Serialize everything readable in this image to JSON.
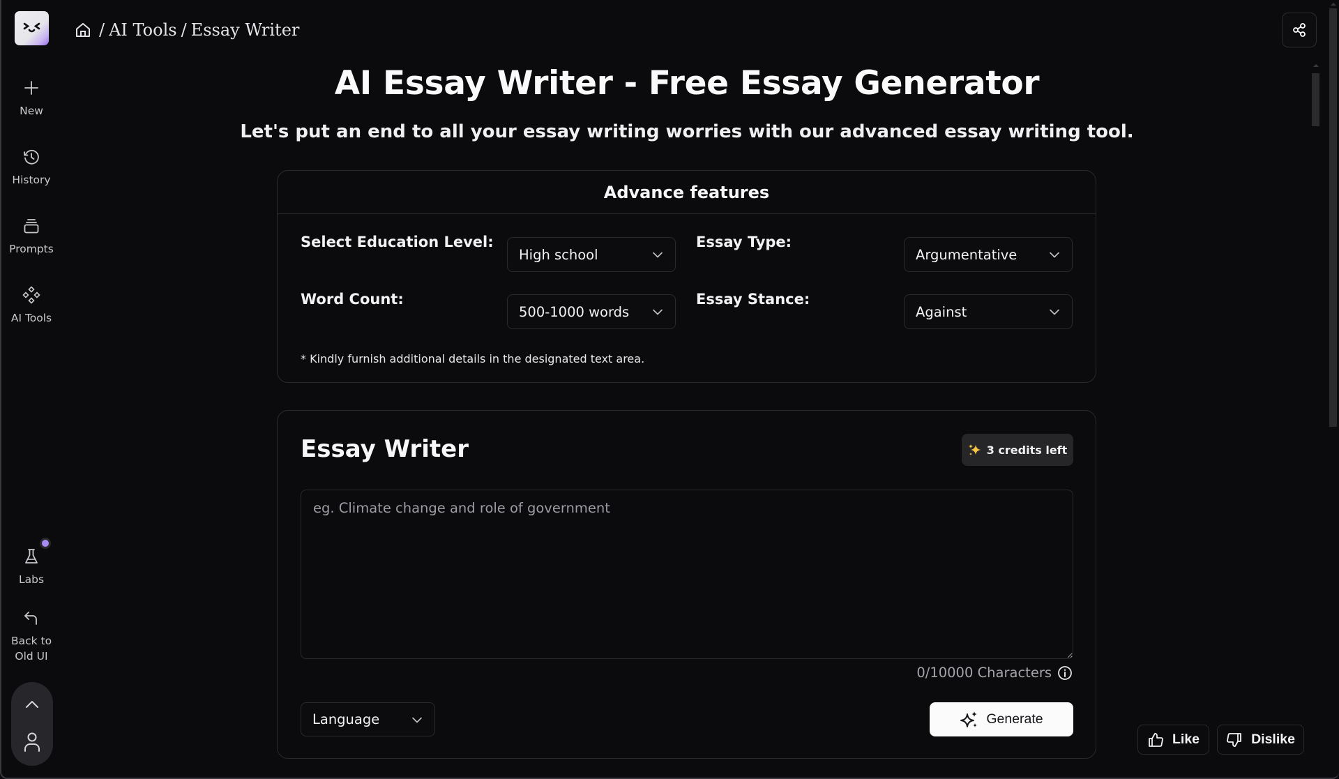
{
  "sidebar": {
    "logo": "smiley-logo",
    "items": [
      {
        "label": "New",
        "icon": "plus-icon"
      },
      {
        "label": "History",
        "icon": "history-icon"
      },
      {
        "label": "Prompts",
        "icon": "stack-icon"
      },
      {
        "label": "AI Tools",
        "icon": "diamonds-icon"
      }
    ],
    "bottom_items": [
      {
        "label": "Labs",
        "icon": "flask-icon",
        "badge_color": "#a98bf4"
      },
      {
        "label_line1": "Back to",
        "label_line2": "Old UI",
        "icon": "back-arrow-icon"
      }
    ],
    "user_menu": {
      "icons": [
        "chevron-up-icon",
        "user-icon"
      ]
    }
  },
  "header": {
    "breadcrumb": [
      "AI Tools",
      "Essay Writer"
    ],
    "separator": "/",
    "share_icon": "share-icon"
  },
  "page": {
    "title": "AI Essay Writer - Free Essay Generator",
    "subtitle": "Let's put an end to all your essay writing worries with our advanced essay writing tool."
  },
  "features": {
    "heading": "Advance features",
    "fields": [
      {
        "label": "Select Education Level:",
        "value": "High school"
      },
      {
        "label": "Essay Type:",
        "value": "Argumentative"
      },
      {
        "label": "Word Count:",
        "value": "500-1000 words"
      },
      {
        "label": "Essay Stance:",
        "value": "Against"
      }
    ],
    "note": "* Kindly furnish additional details in the designated text area."
  },
  "writer": {
    "title": "Essay Writer",
    "credits": "3 credits left",
    "credits_icon_color": "#f5c542",
    "input_value": "",
    "input_placeholder": "eg. Climate change and role of government",
    "char_count": "0/10000 Characters",
    "language_label": "Language",
    "generate_label": "Generate"
  },
  "feedback": {
    "like_label": "Like",
    "dislike_label": "Dislike"
  },
  "colors": {
    "background": "#0b0b0d",
    "border": "#2a2a2e",
    "accent_purple": "#a98bf4",
    "badge_bg": "#262629"
  }
}
